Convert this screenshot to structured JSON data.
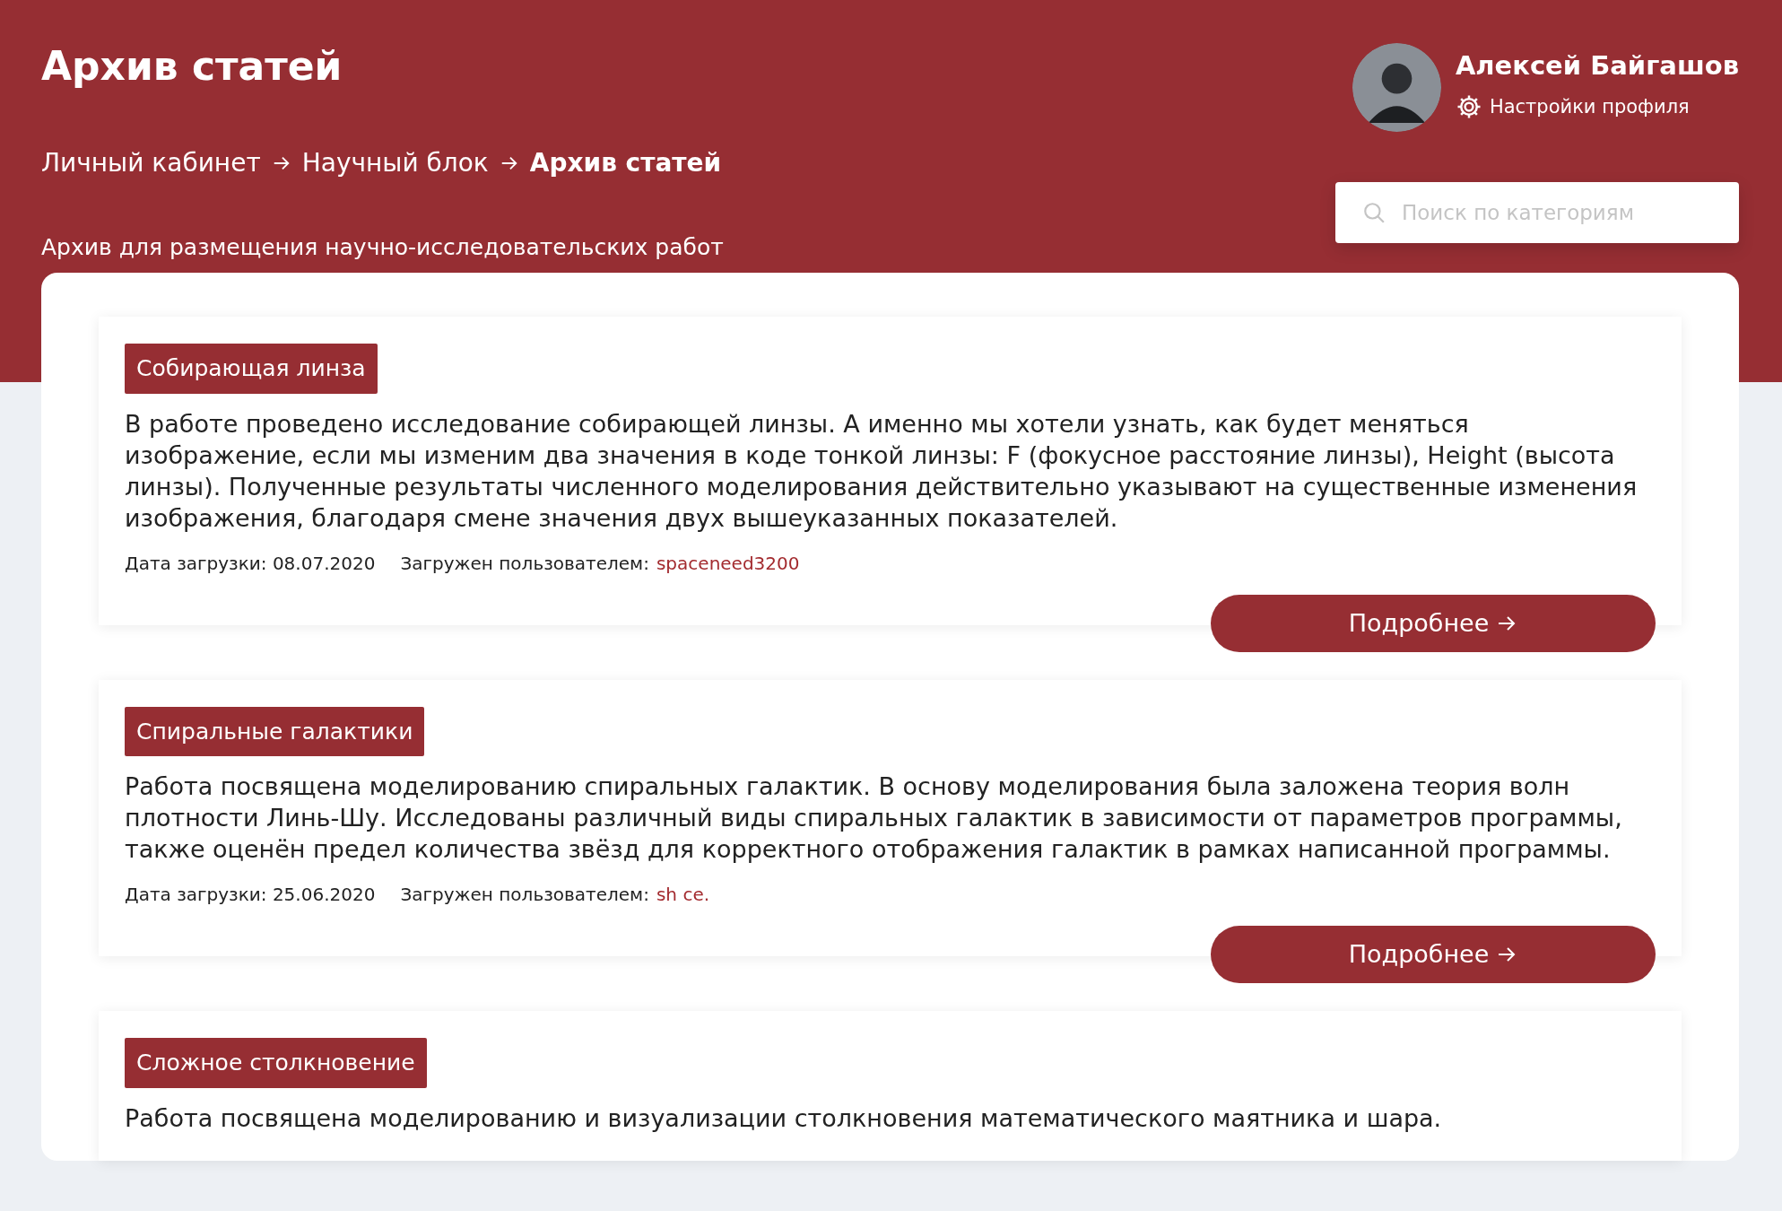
{
  "header": {
    "title": "Архив статей",
    "breadcrumbs": [
      {
        "label": "Личный кабинет",
        "current": false
      },
      {
        "label": "Научный блок",
        "current": false
      },
      {
        "label": "Архив статей",
        "current": true
      }
    ],
    "subtitle": "Архив для размещения научно-исследовательских работ",
    "user": {
      "name": "Алексей Байгашов",
      "settings_link": "Настройки профиля"
    },
    "search": {
      "placeholder": "Поиск по категориям"
    }
  },
  "articles": [
    {
      "tag": "Собирающая линза",
      "description": "В работе проведено исследование собирающей линзы. А именно мы хотели узнать, как будет меняться изображение, если мы изменим два значения в коде тонкой линзы: F (фокусное расстояние линзы), Height (высота линзы). Полученные результаты численного моделирования действительно указывают на существенные изменения изображения, благодаря смене значения двух вышеуказанных показателей.",
      "date": "Дата загрузки: 08.07.2020",
      "uploader_label": "Загружен пользователем:",
      "uploader": "spaceneed3200",
      "button": "Подробнее"
    },
    {
      "tag": "Спиральные галактики",
      "description": "Работа посвящена моделированию спиральных галактик. В основу моделирования была заложена теория волн плотности Линь-Шу. Исследованы различный виды спиральных галактик в зависимости от параметров программы, также оценён предел количества звёзд для корректного отображения галактик в рамках написанной программы.",
      "date": "Дата загрузки: 25.06.2020",
      "uploader_label": "Загружен пользователем:",
      "uploader": "sh ce.",
      "button": "Подробнее"
    },
    {
      "tag": "Сложное столкновение",
      "description": "Работа посвящена моделированию и визуализации столкновения математического маятника и шара."
    }
  ]
}
